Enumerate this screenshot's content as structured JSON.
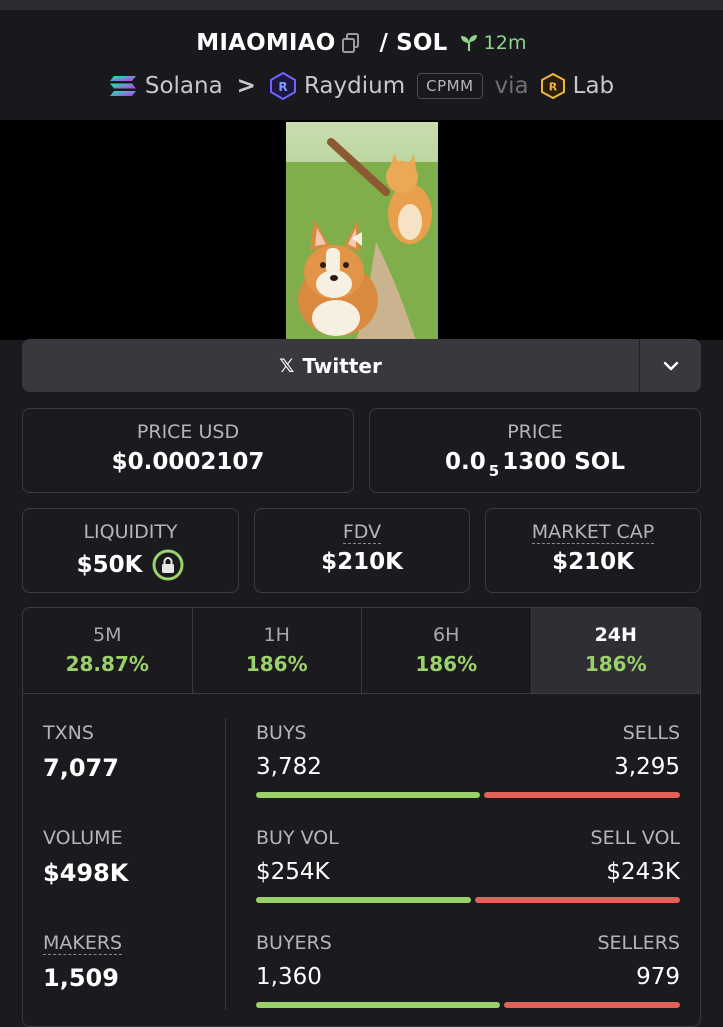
{
  "header": {
    "token": "MIAOMIAO",
    "separator": "/",
    "quote": "SOL",
    "age": "12m",
    "chain": "Solana",
    "dex": "Raydium",
    "pool_type": "CPMM",
    "via": "via",
    "launchpad": "Lab"
  },
  "social": {
    "twitter_label": "Twitter"
  },
  "price": {
    "usd_label": "PRICE USD",
    "usd_value": "$0.0002107",
    "native_label": "PRICE",
    "native_prefix": "0.0",
    "native_zeros": "5",
    "native_suffix": "1300 SOL"
  },
  "market": {
    "liquidity_label": "LIQUIDITY",
    "liquidity_value": "$50K",
    "fdv_label": "FDV",
    "fdv_value": "$210K",
    "mcap_label": "MARKET CAP",
    "mcap_value": "$210K"
  },
  "timeframes": [
    {
      "label": "5M",
      "value": "28.87%"
    },
    {
      "label": "1H",
      "value": "186%"
    },
    {
      "label": "6H",
      "value": "186%"
    },
    {
      "label": "24H",
      "value": "186%"
    }
  ],
  "active_timeframe": "24H",
  "txns": {
    "label": "TXNS",
    "value": "7,077",
    "buys_label": "BUYS",
    "buys": "3,782",
    "sells_label": "SELLS",
    "sells": "3,295",
    "buy_fraction": 0.534
  },
  "volume": {
    "label": "VOLUME",
    "value": "$498K",
    "buy_label": "BUY VOL",
    "buy": "$254K",
    "sell_label": "SELL VOL",
    "sell": "$243K",
    "buy_fraction": 0.511
  },
  "makers": {
    "label": "MAKERS",
    "value": "1,509",
    "buyers_label": "BUYERS",
    "buyers": "1,360",
    "sellers_label": "SELLERS",
    "sellers": "979",
    "buy_fraction": 0.581
  },
  "colors": {
    "positive": "#9ad16a",
    "negative": "#e0625a",
    "age": "#8fd38f"
  }
}
